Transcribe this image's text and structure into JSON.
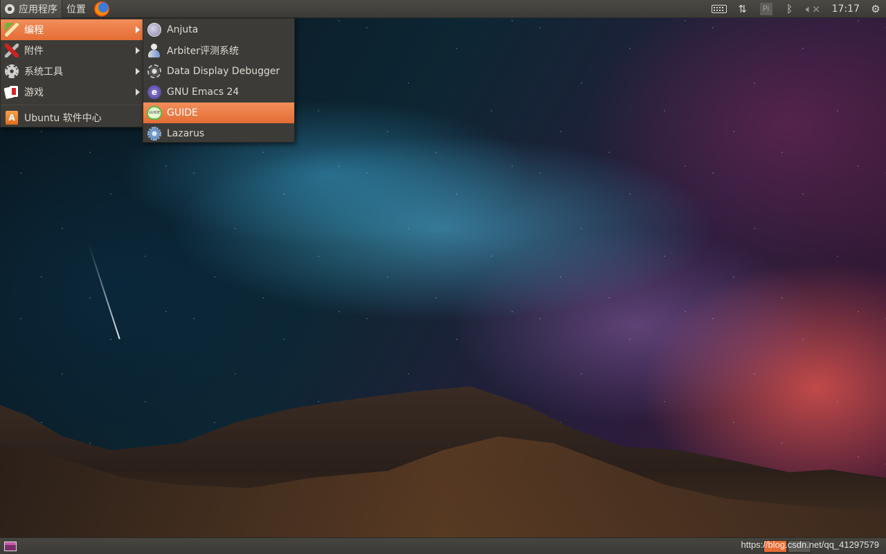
{
  "top_panel": {
    "applications_label": "应用程序",
    "places_label": "位置",
    "clock": "17:17",
    "pi_label": "Pi"
  },
  "main_menu": {
    "items": [
      {
        "label": "编程",
        "icon": "brush-icon",
        "has_submenu": true,
        "highlighted": true
      },
      {
        "label": "附件",
        "icon": "tools-icon",
        "has_submenu": true
      },
      {
        "label": "系统工具",
        "icon": "gear-icon",
        "has_submenu": true
      },
      {
        "label": "游戏",
        "icon": "cards-icon",
        "has_submenu": true
      }
    ],
    "footer_item": {
      "label": "Ubuntu 软件中心",
      "icon": "software-center-icon"
    }
  },
  "sub_menu": {
    "items": [
      {
        "label": "Anjuta",
        "icon": "anjuta-icon"
      },
      {
        "label": "Arbiter评测系统",
        "icon": "arbiter-icon"
      },
      {
        "label": "Data Display Debugger",
        "icon": "ddd-icon"
      },
      {
        "label": "GNU Emacs 24",
        "icon": "emacs-icon"
      },
      {
        "label": "GUIDE",
        "icon": "guide-icon",
        "highlighted": true,
        "icon_text": "GUIDE"
      },
      {
        "label": "Lazarus",
        "icon": "lazarus-icon"
      }
    ]
  },
  "watermark": "https://blog.csdn.net/qq_41297579",
  "colors": {
    "panel": "#3c3b37",
    "highlight": "#e46d34",
    "text": "#dfdbd2"
  }
}
